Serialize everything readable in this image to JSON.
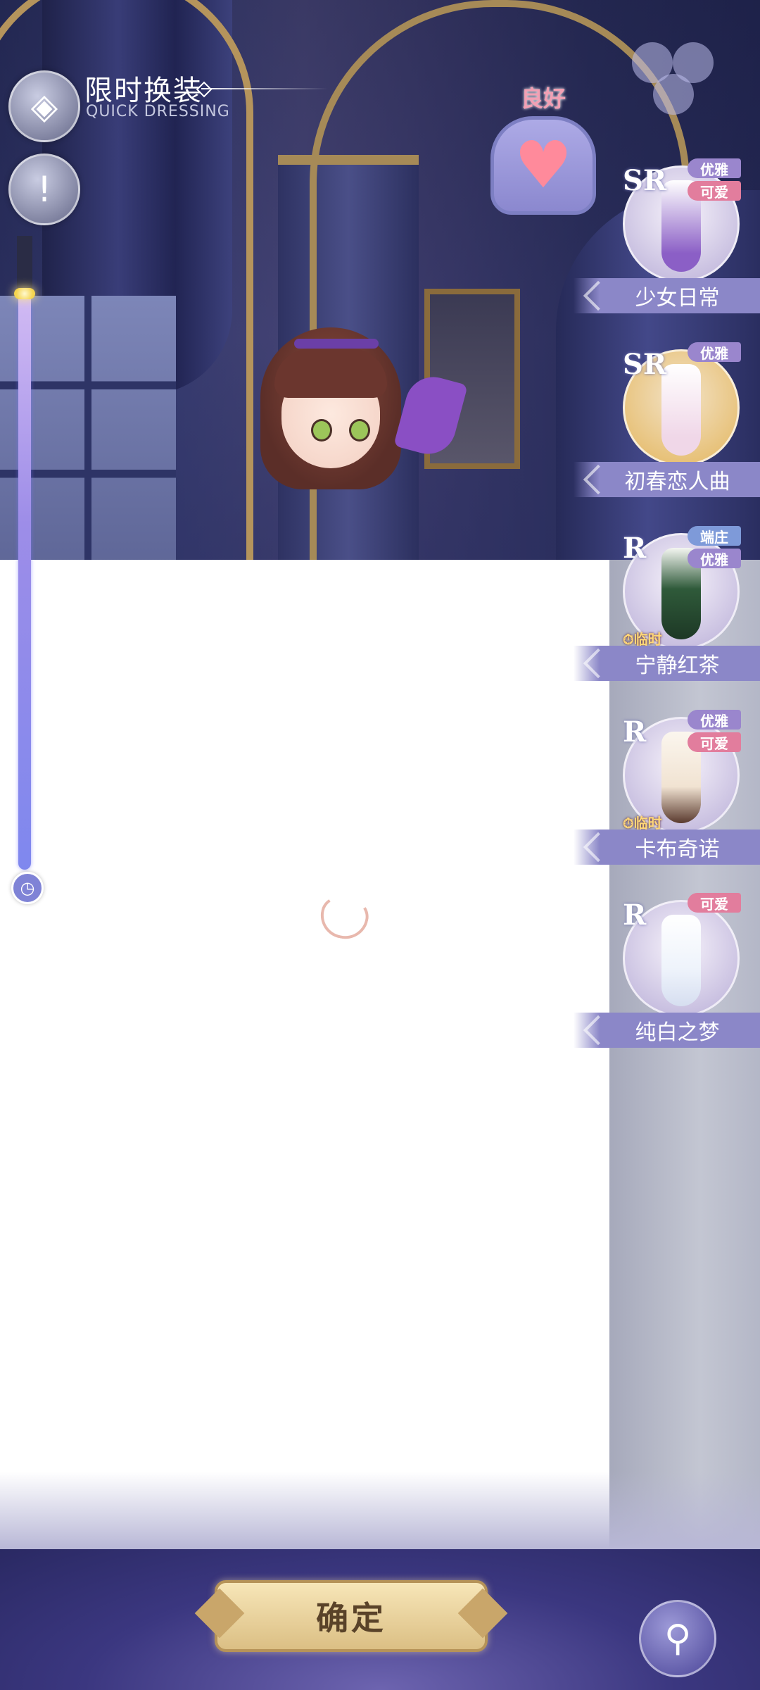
{
  "header": {
    "title": "限时换装",
    "subtitle": "QUICK DRESSING"
  },
  "mood": {
    "label": "良好",
    "heart_color": "#ff8a9b"
  },
  "icons": {
    "back": "diamond-back-icon",
    "info": "exclamation-icon",
    "clock": "clock-icon",
    "hint": "key-icon",
    "top_right": "clover-icon"
  },
  "outfits": [
    {
      "rarity": "SR",
      "name": "少女日常",
      "tags": [
        "优雅",
        "可爱"
      ],
      "timer": ""
    },
    {
      "rarity": "SR",
      "name": "初春恋人曲",
      "tags": [
        "优雅"
      ],
      "timer": ""
    },
    {
      "rarity": "R",
      "name": "宁静红茶",
      "tags": [
        "端庄",
        "优雅"
      ],
      "timer": "临时"
    },
    {
      "rarity": "R",
      "name": "卡布奇诺",
      "tags": [
        "优雅",
        "可爱"
      ],
      "timer": "临时"
    },
    {
      "rarity": "R",
      "name": "纯白之梦",
      "tags": [
        "可爱"
      ],
      "timer": ""
    }
  ],
  "footer": {
    "confirm_label": "确定"
  },
  "colors": {
    "accent": "#8b87c8",
    "tag_elegant": "#9a86cd",
    "tag_cute": "#e27d9d",
    "tag_formal": "#7e9ad9",
    "confirm_gold": "#dbbf84"
  }
}
